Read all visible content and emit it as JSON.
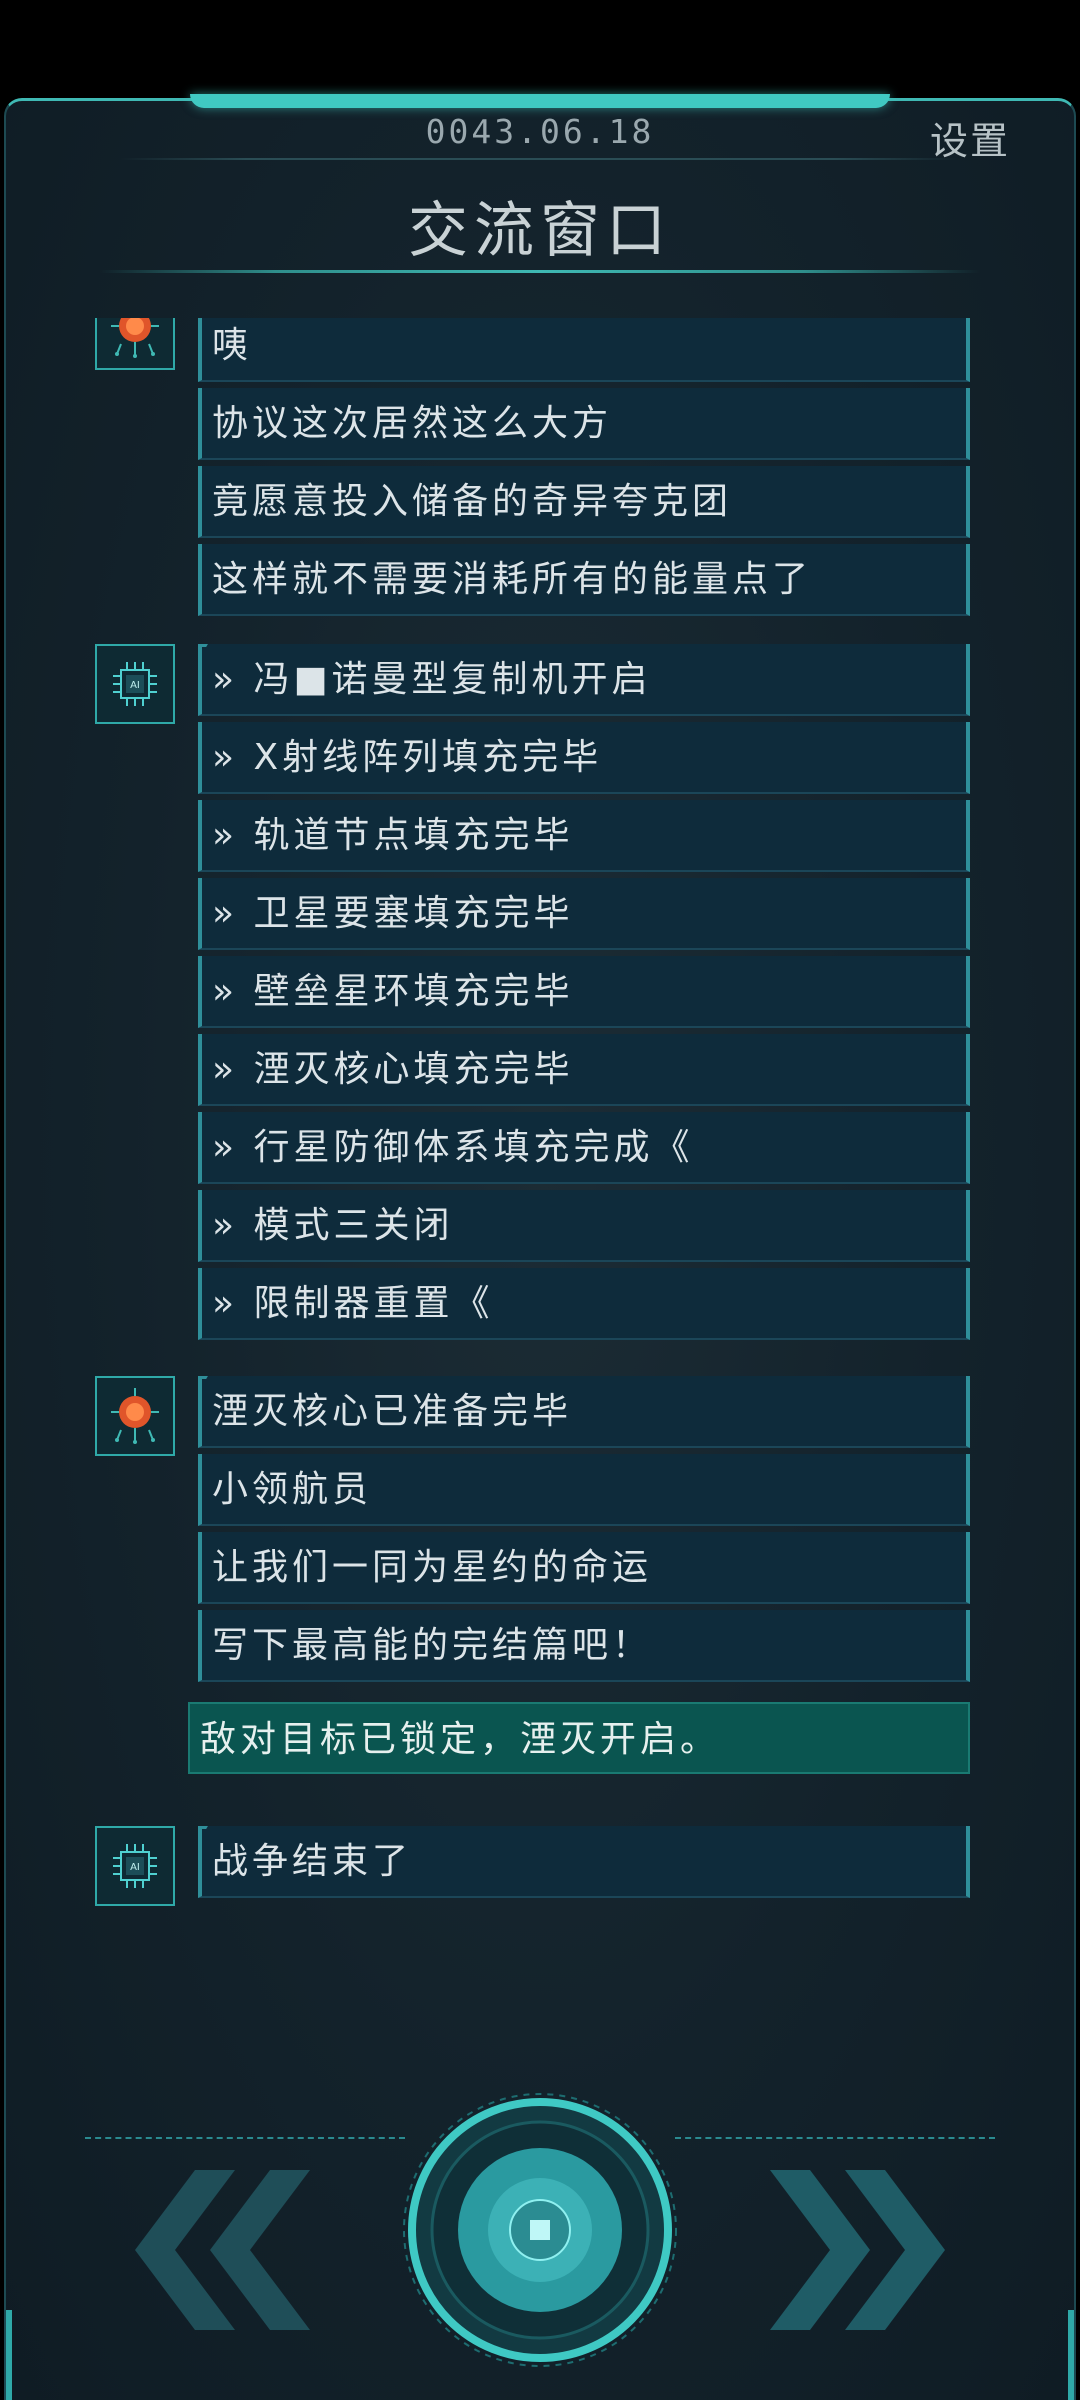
{
  "header": {
    "date": "0043.06.18",
    "settings_label": "设置",
    "title": "交流窗口"
  },
  "messages": [
    {
      "speaker_icon": "orange-core-avatar-icon",
      "lines": [
        "咦",
        "协议这次居然这么大方",
        "竟愿意投入储备的奇异夸克团",
        "这样就不需要消耗所有的能量点了"
      ]
    },
    {
      "speaker_icon": "ai-chip-avatar-icon",
      "lines": [
        "» 冯■诺曼型复制机开启",
        "» X射线阵列填充完毕",
        "» 轨道节点填充完毕",
        "» 卫星要塞填充完毕",
        "» 壁垒星环填充完毕",
        "» 湮灭核心填充完毕",
        "» 行星防御体系填充完成《",
        "» 模式三关闭",
        "» 限制器重置《"
      ]
    },
    {
      "speaker_icon": "orange-core-avatar-icon",
      "lines": [
        "湮灭核心已准备完毕",
        "小领航员",
        "让我们一同为星约的命运",
        "写下最高能的完结篇吧！"
      ]
    },
    {
      "speaker_icon": "none",
      "highlight": true,
      "lines": [
        "敌对目标已锁定，湮灭开启。"
      ]
    },
    {
      "speaker_icon": "ai-chip-avatar-icon",
      "lines": [
        "战争结束了"
      ]
    }
  ],
  "controls": {
    "prev_icon": "double-chevron-left-icon",
    "center_icon": "center-core-button-icon",
    "next_icon": "double-chevron-right-icon"
  },
  "colors": {
    "accent": "#3fb9b4",
    "bubble_bg": "#0e2b3b",
    "highlight_bg": "#0a5550",
    "core_orange": "#e0552a"
  }
}
